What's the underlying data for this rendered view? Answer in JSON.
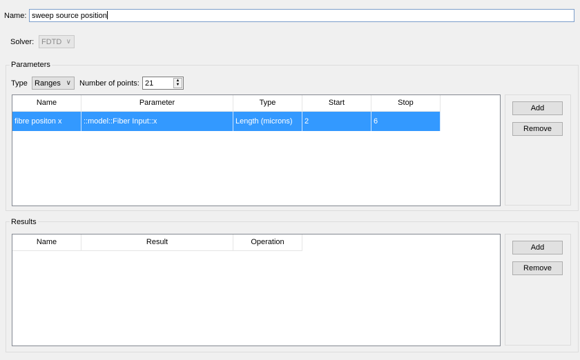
{
  "name": {
    "label": "Name:",
    "value": "sweep source position"
  },
  "solver": {
    "label": "Solver:",
    "value": "FDTD",
    "icon": "chevron-down-icon"
  },
  "parameters": {
    "title": "Parameters",
    "type_label": "Type",
    "type_value": "Ranges",
    "num_points_label": "Number of points:",
    "num_points_value": "21",
    "columns": [
      "Name",
      "Parameter",
      "Type",
      "Start",
      "Stop"
    ],
    "rows": [
      {
        "name": "fibre positon x",
        "parameter": "::model::Fiber Input::x",
        "type": "Length (microns)",
        "start": "2",
        "stop": "6",
        "selected": true
      }
    ],
    "add_label": "Add",
    "remove_label": "Remove"
  },
  "results": {
    "title": "Results",
    "columns": [
      "Name",
      "Result",
      "Operation"
    ],
    "rows": [],
    "add_label": "Add",
    "remove_label": "Remove"
  },
  "colors": {
    "selection": "#3399ff",
    "focus_border": "#7a9cc9",
    "background": "#f0f0f0"
  }
}
